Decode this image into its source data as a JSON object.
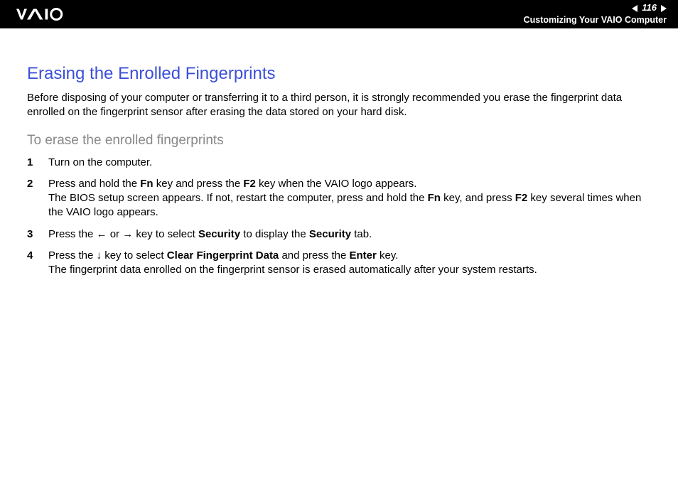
{
  "header": {
    "page_number": "116",
    "breadcrumb": "Customizing Your VAIO Computer"
  },
  "title": "Erasing the Enrolled Fingerprints",
  "intro": "Before disposing of your computer or transferring it to a third person, it is strongly recommended you erase the fingerprint data enrolled on the fingerprint sensor after erasing the data stored on your hard disk.",
  "subhead": "To erase the enrolled fingerprints",
  "steps": {
    "s1": {
      "num": "1",
      "body": "Turn on the computer."
    },
    "s2": {
      "num": "2",
      "p1a": "Press and hold the ",
      "p1b": "Fn",
      "p1c": " key and press the ",
      "p1d": "F2",
      "p1e": " key when the VAIO logo appears.",
      "p2a": "The BIOS setup screen appears. If not, restart the computer, press and hold the ",
      "p2b": "Fn",
      "p2c": " key, and press ",
      "p2d": "F2",
      "p2e": " key several times when the VAIO logo appears."
    },
    "s3": {
      "num": "3",
      "a": "Press the ",
      "b": " or ",
      "c": " key to select ",
      "d": "Security",
      "e": " to display the ",
      "f": "Security",
      "g": " tab."
    },
    "s4": {
      "num": "4",
      "a": "Press the ",
      "b": " key to select ",
      "c": "Clear Fingerprint Data",
      "d": " and press the ",
      "e": "Enter",
      "f": " key.",
      "p2": "The fingerprint data enrolled on the fingerprint sensor is erased automatically after your system restarts."
    }
  }
}
